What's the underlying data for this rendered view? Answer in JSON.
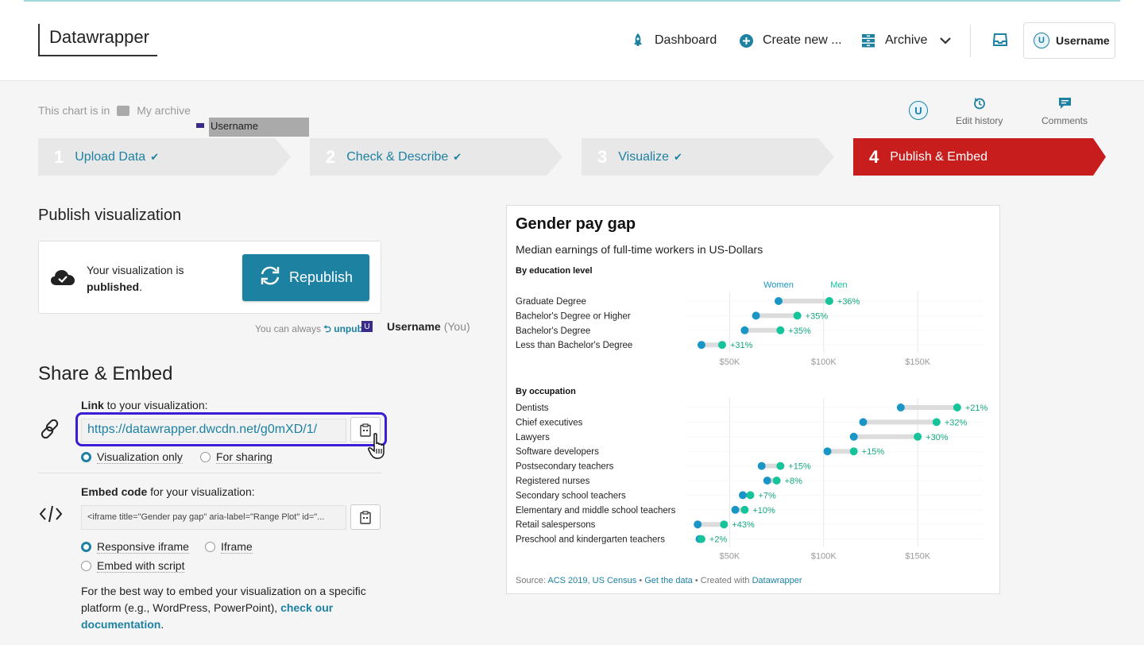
{
  "app": {
    "logo": "Datawrapper",
    "nav": {
      "dashboard": "Dashboard",
      "create_new": "Create new ...",
      "archive": "Archive",
      "user": "Username",
      "user_initial": "U"
    }
  },
  "location": {
    "prefix": "This chart is in",
    "folder": "My archive",
    "tooltip_user": "Username"
  },
  "tools": {
    "avatar_initial": "U",
    "edit_history": "Edit history",
    "comments": "Comments"
  },
  "steps": [
    {
      "num": "1",
      "label": "Upload Data",
      "done": true
    },
    {
      "num": "2",
      "label": "Check & Describe",
      "done": true
    },
    {
      "num": "3",
      "label": "Visualize",
      "done": true
    },
    {
      "num": "4",
      "label": "Publish & Embed",
      "active": true
    }
  ],
  "publish": {
    "heading": "Publish visualization",
    "status_line1": "Your visualization is",
    "status_bold": "published",
    "status_end": ".",
    "republish_button": "Republish",
    "unpublish_prefix": "You can always",
    "unpublish_link": "unpublish.",
    "presence_initial": "U",
    "presence_user": "Username",
    "presence_you": "(You)"
  },
  "share": {
    "heading": "Share & Embed",
    "link_label_bold": "Link",
    "link_label_rest": " to your visualization:",
    "url": "https://datawrapper.dwcdn.net/g0mXD/1/",
    "link_options": [
      "Visualization only",
      "For sharing"
    ],
    "link_selected": 0,
    "embed_label_bold": "Embed code",
    "embed_label_rest": " for your visualization:",
    "embed_code": "<iframe title=\"Gender pay gap\" aria-label=\"Range Plot\" id=\"...",
    "embed_options": [
      "Responsive iframe",
      "Iframe",
      "Embed with script"
    ],
    "embed_selected": 0,
    "best_way_text": "For the best way to embed your visualization on a specific platform (e.g., WordPress, PowerPoint), ",
    "best_way_link": "check our documentation",
    "best_way_end": "."
  },
  "colors": {
    "accent": "#1d81a2",
    "active_step": "#c71e1d",
    "women": "#1a96c6",
    "men": "#15c49a",
    "focus": "#3a1dd4"
  },
  "chart_data": {
    "type": "range",
    "title": "Gender pay gap",
    "subtitle": "Median earnings of full-time workers in US-Dollars",
    "legend": [
      "Women",
      "Men"
    ],
    "x_ticks": [
      "$50K",
      "$100K",
      "$150K"
    ],
    "x_tick_values": [
      50000,
      100000,
      150000
    ],
    "xlim": [
      27000,
      185000
    ],
    "groups": [
      {
        "name": "By education level",
        "rows": [
          {
            "label": "Graduate Degree",
            "women": 76000,
            "men": 103000,
            "diff": "+36%"
          },
          {
            "label": "Bachelor's Degree or Higher",
            "women": 64000,
            "men": 86000,
            "diff": "+35%"
          },
          {
            "label": "Bachelor's Degree",
            "women": 58000,
            "men": 77000,
            "diff": "+35%"
          },
          {
            "label": "Less than Bachelor's Degree",
            "women": 35000,
            "men": 46000,
            "diff": "+31%"
          }
        ]
      },
      {
        "name": "By occupation",
        "rows": [
          {
            "label": "Dentists",
            "women": 141000,
            "men": 171000,
            "diff": "+21%"
          },
          {
            "label": "Chief executives",
            "women": 121000,
            "men": 160000,
            "diff": "+32%"
          },
          {
            "label": "Lawyers",
            "women": 116000,
            "men": 150000,
            "diff": "+30%"
          },
          {
            "label": "Software developers",
            "women": 102000,
            "men": 116000,
            "diff": "+15%"
          },
          {
            "label": "Postsecondary teachers",
            "women": 67000,
            "men": 77000,
            "diff": "+15%"
          },
          {
            "label": "Registered nurses",
            "women": 70000,
            "men": 75000,
            "diff": "+8%"
          },
          {
            "label": "Secondary school teachers",
            "women": 57000,
            "men": 61000,
            "diff": "+7%"
          },
          {
            "label": "Elementary and middle school teachers",
            "women": 53000,
            "men": 58000,
            "diff": "+10%"
          },
          {
            "label": "Retail salespersons",
            "women": 33000,
            "men": 47000,
            "diff": "+43%"
          },
          {
            "label": "Preschool and kindergarten teachers",
            "women": 34000,
            "men": 35000,
            "diff": "+2%"
          }
        ]
      }
    ],
    "source_prefix": "Source:",
    "source_link": "ACS 2019, US Census",
    "get_data": "Get the data",
    "created_with": "Created with",
    "created_link": "Datawrapper"
  }
}
